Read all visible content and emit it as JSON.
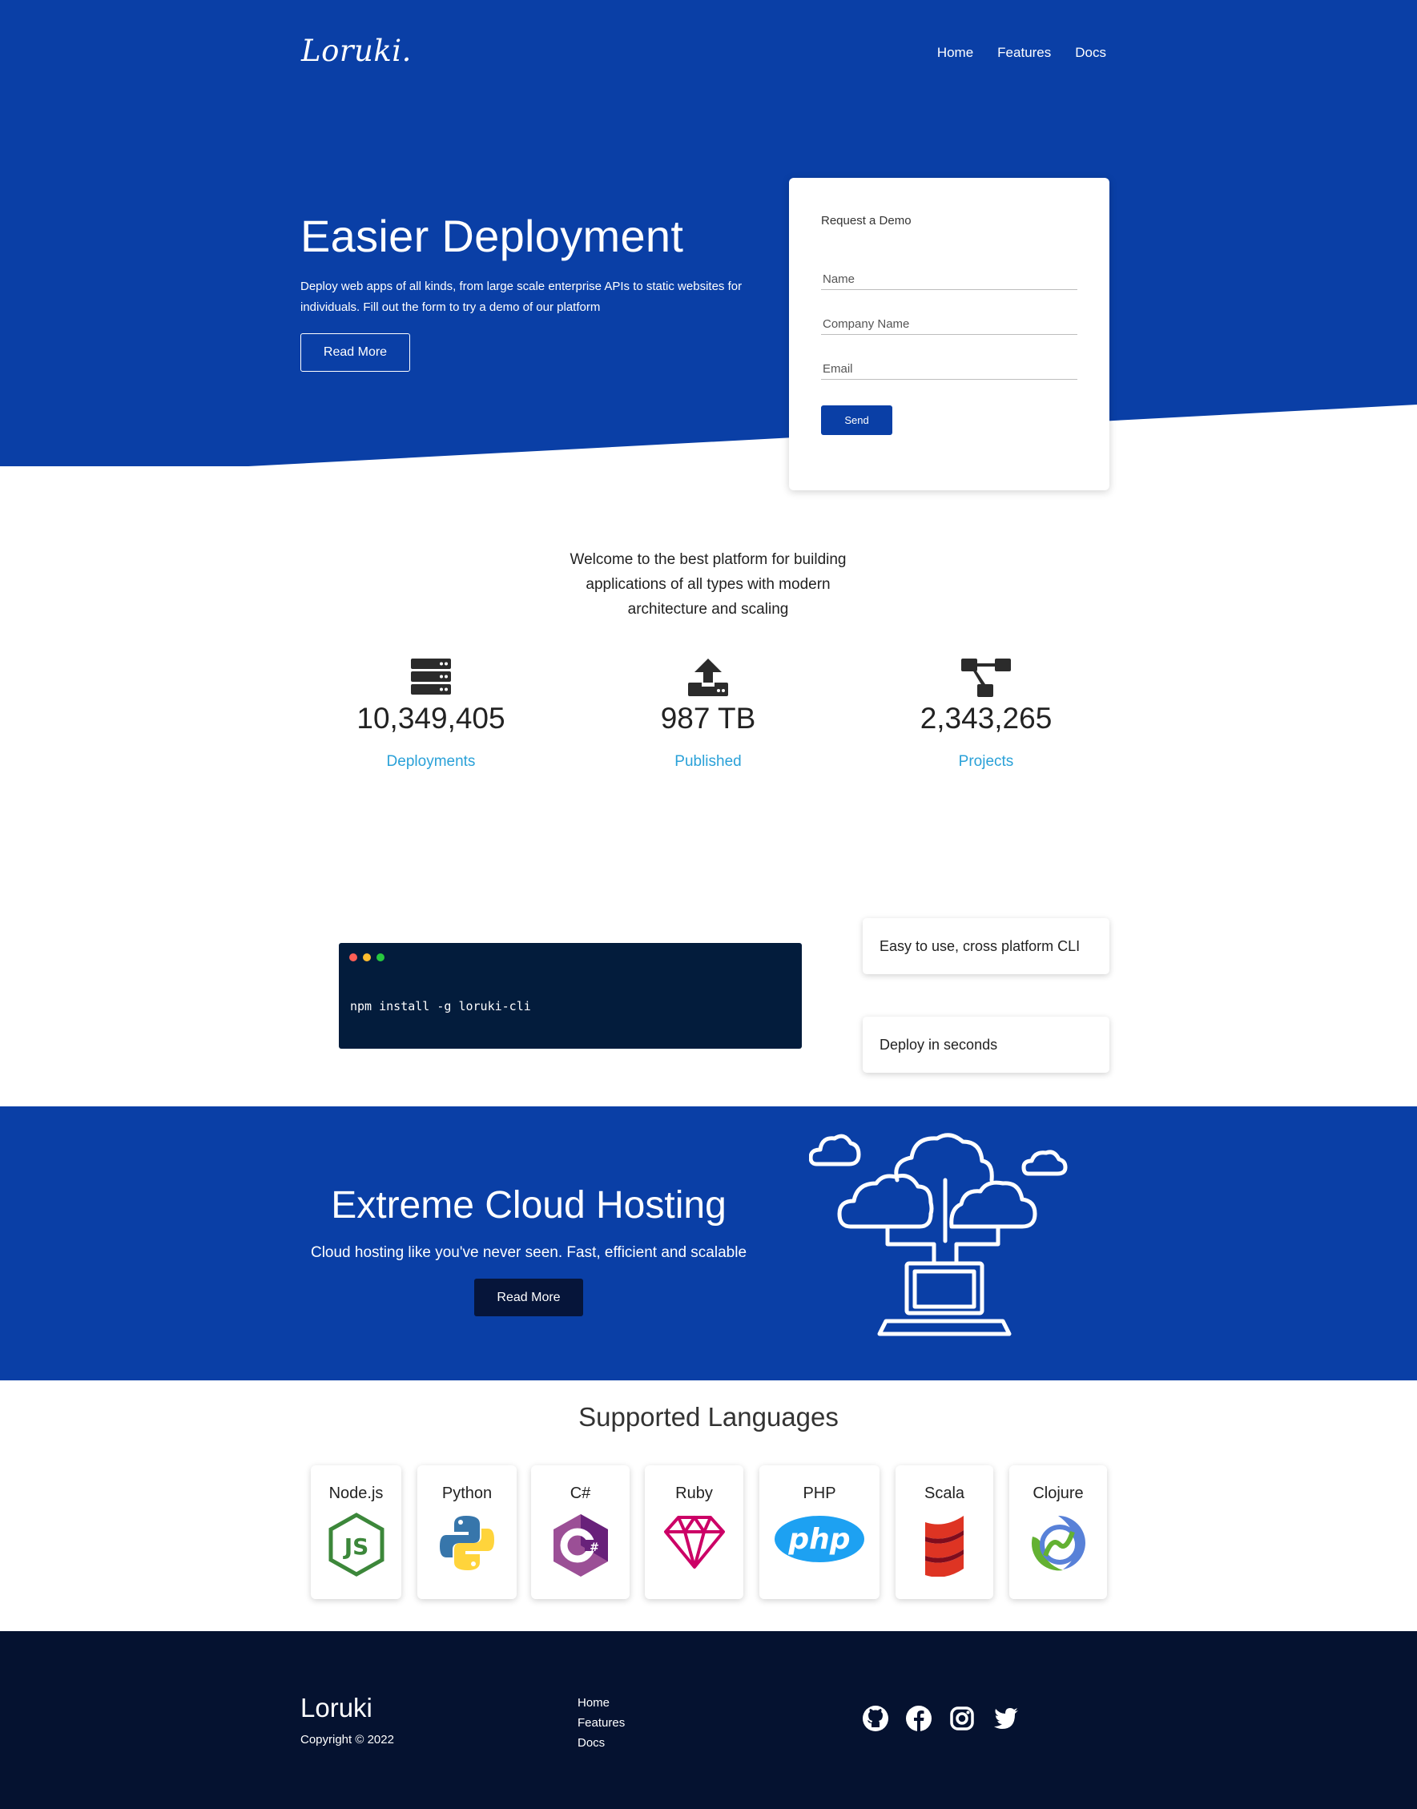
{
  "header": {
    "logo": "Loruki.",
    "nav": [
      "Home",
      "Features",
      "Docs"
    ]
  },
  "hero": {
    "title": "Easier Deployment",
    "description": "Deploy web apps of all kinds, from large scale enterprise APIs to static websites for individuals. Fill out the form to try a demo of our platform",
    "button": "Read More"
  },
  "demo_form": {
    "title": "Request a Demo",
    "name_placeholder": "Name",
    "company_placeholder": "Company Name",
    "email_placeholder": "Email",
    "send": "Send"
  },
  "stats": {
    "intro": "Welcome to the best platform for building applications of all types with modern architecture and scaling",
    "items": [
      {
        "icon": "server-icon",
        "value": "10,349,405",
        "label": "Deployments"
      },
      {
        "icon": "upload-icon",
        "value": "987 TB",
        "label": "Published"
      },
      {
        "icon": "project-diagram-icon",
        "value": "2,343,265",
        "label": "Projects"
      }
    ]
  },
  "cli": {
    "command": "npm install -g loruki-cli",
    "features": [
      "Easy to use, cross platform CLI",
      "Deploy in seconds"
    ]
  },
  "cloud": {
    "title": "Extreme Cloud Hosting",
    "description": "Cloud hosting like you've never seen. Fast, efficient and scalable",
    "button": "Read More"
  },
  "languages": {
    "title": "Supported Languages",
    "items": [
      {
        "name": "Node.js",
        "icon": "nodejs-icon"
      },
      {
        "name": "Python",
        "icon": "python-icon"
      },
      {
        "name": "C#",
        "icon": "csharp-icon"
      },
      {
        "name": "Ruby",
        "icon": "ruby-icon"
      },
      {
        "name": "PHP",
        "icon": "php-icon"
      },
      {
        "name": "Scala",
        "icon": "scala-icon"
      },
      {
        "name": "Clojure",
        "icon": "clojure-icon"
      }
    ]
  },
  "footer": {
    "brand": "Loruki",
    "copyright": "Copyright © 2022",
    "links": [
      "Home",
      "Features",
      "Docs"
    ],
    "socials": [
      "github-icon",
      "facebook-icon",
      "instagram-icon",
      "twitter-icon"
    ]
  },
  "colors": {
    "primary": "#0a3fa6",
    "dark": "#051230",
    "terminal": "#031c3c",
    "accent": "#2aa1d8"
  }
}
